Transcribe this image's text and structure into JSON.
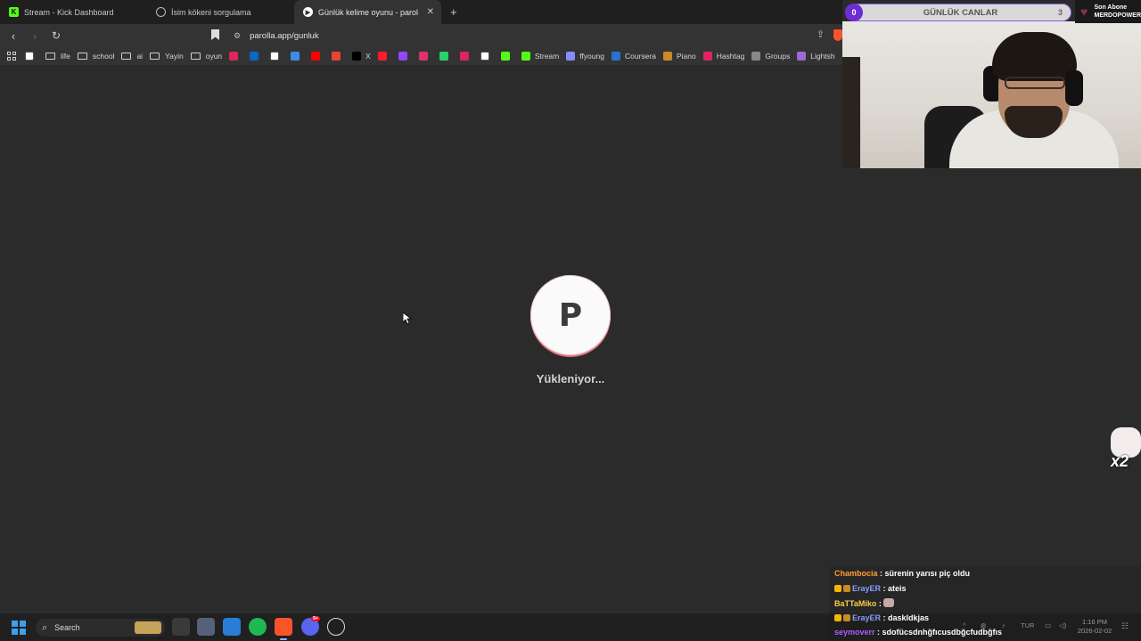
{
  "browser": {
    "tabs": [
      {
        "label": "Stream - Kick Dashboard",
        "icon": "kick-icon",
        "color": "#53fc18",
        "active": false
      },
      {
        "label": "İsim kökeni sorgulama",
        "icon": "globe-icon",
        "color": "#bbbbbb",
        "active": false
      },
      {
        "label": "Günlük kelime oyunu - parolla -",
        "icon": "parolla-icon",
        "color": "#ffffff",
        "active": true
      }
    ],
    "url": "parolla.app/gunluk",
    "bookmarks": [
      {
        "label": "",
        "icon": "google-icon",
        "color": "#ffffff"
      },
      {
        "label": "life",
        "icon": "folder-icon"
      },
      {
        "label": "school",
        "icon": "folder-icon"
      },
      {
        "label": "ai",
        "icon": "folder-icon"
      },
      {
        "label": "Yayin",
        "icon": "folder-icon"
      },
      {
        "label": "oyun",
        "icon": "folder-icon"
      },
      {
        "label": "",
        "icon": "red-icon",
        "color": "#e0245e"
      },
      {
        "label": "",
        "icon": "linkedin-icon",
        "color": "#0a66c2"
      },
      {
        "label": "",
        "icon": "google-icon",
        "color": "#ffffff"
      },
      {
        "label": "",
        "icon": "edge-icon",
        "color": "#3a8ee6"
      },
      {
        "label": "",
        "icon": "youtube-icon",
        "color": "#ff0000"
      },
      {
        "label": "",
        "icon": "gmail-icon",
        "color": "#ea4335"
      },
      {
        "label": "X",
        "icon": "x-icon",
        "color": "#000000"
      },
      {
        "label": "",
        "icon": "opera-icon",
        "color": "#ff1b2d"
      },
      {
        "label": "",
        "icon": "twitch-icon",
        "color": "#9146ff"
      },
      {
        "label": "",
        "icon": "instagram-icon",
        "color": "#e1306c"
      },
      {
        "label": "",
        "icon": "whatsapp-icon",
        "color": "#25d366"
      },
      {
        "label": "",
        "icon": "tumblr-icon",
        "color": "#e0245e"
      },
      {
        "label": "",
        "icon": "amazon-icon",
        "color": "#ffffff"
      },
      {
        "label": "",
        "icon": "kick-icon",
        "color": "#53fc18"
      },
      {
        "label": "Stream",
        "icon": "kick-icon",
        "color": "#53fc18"
      },
      {
        "label": "ffyoung",
        "icon": "wave-icon",
        "color": "#8a8aff"
      },
      {
        "label": "Coursera",
        "icon": "coursera-icon",
        "color": "#2a73cc"
      },
      {
        "label": "Piano",
        "icon": "piano-icon",
        "color": "#c98a2b"
      },
      {
        "label": "Hashtag",
        "icon": "hashtag-icon",
        "color": "#e0245e"
      },
      {
        "label": "Groups",
        "icon": "link-icon",
        "color": "#888888"
      },
      {
        "label": "Lightsh",
        "icon": "feather-icon",
        "color": "#9b6bd6"
      }
    ]
  },
  "page": {
    "logo_letter": "P",
    "loading_text": "Yükleniyor..."
  },
  "overlay": {
    "goal": {
      "current": "0",
      "title": "GÜNLÜK CANLAR",
      "target": "3"
    },
    "sub": {
      "line1": "Son Abone",
      "line2": "MERDOPOWER"
    },
    "emote_text": "x2",
    "chat": [
      {
        "user": "Chambocia",
        "user_color": "#ff9f2e",
        "message": "sürenin yarısı piç oldu",
        "badges": false
      },
      {
        "user": "ErayER",
        "user_color": "#8a9cff",
        "message": "ateis",
        "badges": true
      },
      {
        "user": "BaTTaMiko",
        "user_color": "#f5d142",
        "message": "",
        "badges": false
      },
      {
        "user": "ErayER",
        "user_color": "#8a9cff",
        "message": "daskldkjas",
        "badges": true
      },
      {
        "user": "seymoverr",
        "user_color": "#b05cff",
        "message": "sdofücsdnhğfıcusdbğcfudbğfıs",
        "badges": false
      }
    ]
  },
  "taskbar": {
    "search_label": "Search",
    "tray_lang": "TUR",
    "time": "1:16 PM",
    "date": "2026-02-02",
    "discord_badge": "9+"
  }
}
